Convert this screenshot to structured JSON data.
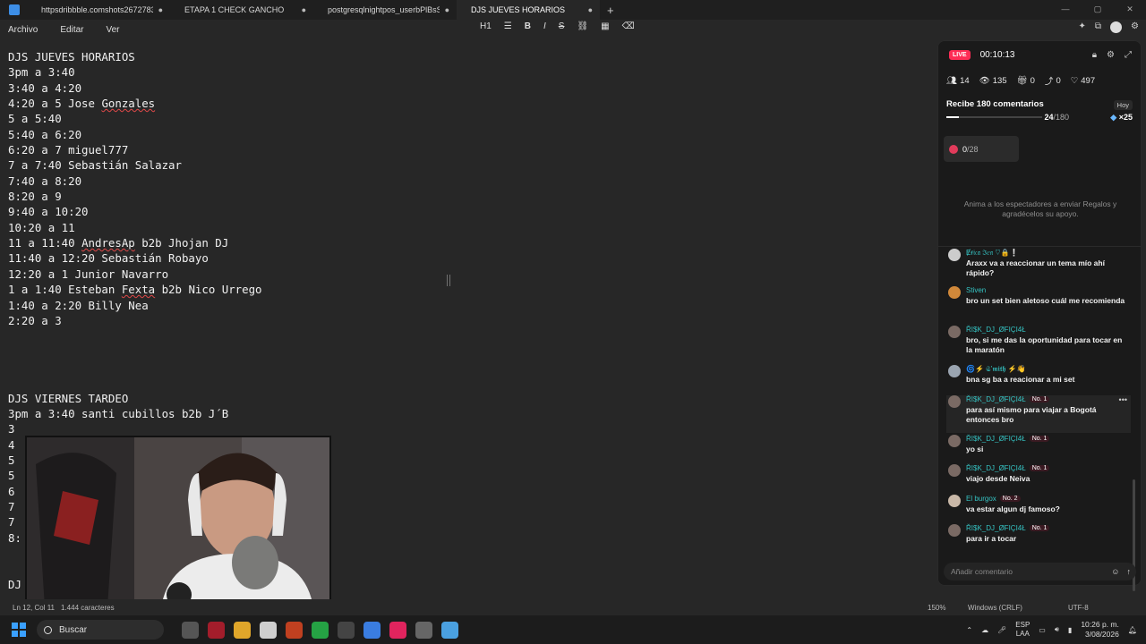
{
  "tabs": [
    {
      "label": "httpsdribbble.comshots26727839-M",
      "close": "●"
    },
    {
      "label": "ETAPA 1 CHECK GANCHO",
      "close": "●"
    },
    {
      "label": "postgresqlnightpos_userbPlBsSh6o1",
      "close": "●"
    },
    {
      "label": "DJS JUEVES HORARIOS",
      "close": "●"
    }
  ],
  "new_tab": "+",
  "window_controls": [
    "—",
    "▢",
    "✕"
  ],
  "menu": [
    "Archivo",
    "Editar",
    "Ver"
  ],
  "format_toolbar": {
    "heading": "H1",
    "list": "☰",
    "bold": "B",
    "italic": "I",
    "strike": "S",
    "link": "⛓",
    "table": "▦",
    "clear": "⌫"
  },
  "editor_lines": [
    "DJS JUEVES HORARIOS",
    "3pm a 3:40",
    "3:40 a 4:20",
    "4:20 a 5 Jose Gonzales",
    "5 a 5:40",
    "5:40 a 6:20",
    "6:20 a 7 miguel777",
    "7 a 7:40 Sebastián Salazar",
    "7:40 a 8:20",
    "8:20 a 9",
    "9:40 a 10:20",
    "10:20 a 11",
    "11 a 11:40 AndresAp b2b Jhojan DJ",
    "11:40 a 12:20 Sebastián Robayo",
    "12:20 a 1 Junior Navarro",
    "1 a 1:40 Esteban Fexta b2b Nico Urrego",
    "1:40 a 2:20 Billy Nea",
    "2:20 a 3",
    "",
    "",
    "",
    "",
    "DJS VIERNES TARDEO",
    "3pm a 3:40 santi cubillos b2b J´B",
    "3",
    "4",
    "5",
    "5",
    "6",
    "7",
    "7",
    "8:",
    "",
    "",
    "DJ"
  ],
  "status": {
    "position": "Ln 12, Col 11",
    "chars": "1.444 caracteres",
    "zoom": "150%",
    "eol": "Windows (CRLF)",
    "encoding": "UTF-8"
  },
  "taskbar": {
    "search": "Buscar",
    "lang": "ESP",
    "lang2": "LAA",
    "time": "10:26 p. m.",
    "date": "3/08/2026"
  },
  "live": {
    "badge": "LIVE",
    "timer": "00:10:13",
    "stats": {
      "users": "14",
      "views": "135",
      "gifts": "0",
      "shares": "0",
      "likes": "497"
    },
    "goal_title": "Recibe 180 comentarios",
    "goal_day": "Hoy",
    "goal_count": "24",
    "goal_total": "/180",
    "goal_reward": "×25",
    "goal_progress": 0.133,
    "gift_count": "0",
    "gift_total": "/28",
    "prompt": "Anima a los espectadores a enviar Regalos y agradécelos su apoyo.",
    "input_placeholder": "Añadir comentario"
  },
  "chat": [
    {
      "user": "Ɇɍ𝔦𝔠𝔞 ℑ𝔢𝔫 ♡🔒❕",
      "badge": "",
      "text": "Araxx va a reaccionar un tema mío ahí rápido?",
      "color": "#cccccc"
    },
    {
      "user": "Stiven",
      "badge": "",
      "text": "bro un set bien aletoso cuál me recomienda",
      "color": "#d0883a"
    },
    {
      "user": "ŘI$K_DJ_ØFIÇI4Ł",
      "badge": "",
      "text": "bro, si me das la oportunidad para tocar en la maratón",
      "color": "#7a6a64"
    },
    {
      "user": "🌀⚡ 𝕾’𝖒𝖎𝖙𝖍 ⚡👋",
      "badge": "",
      "text": "bna sg ba a reacionar a mi set",
      "color": "#9aa4b0"
    },
    {
      "user": "ŘI$K_DJ_ØFIÇI4Ł",
      "badge": "No. 1",
      "text": "para así mismo para viajar a Bogotá entonces bro",
      "color": "#7a6a64"
    },
    {
      "user": "ŘI$K_DJ_ØFIÇI4Ł",
      "badge": "No. 1",
      "text": "yo si",
      "color": "#7a6a64"
    },
    {
      "user": "ŘI$K_DJ_ØFIÇI4Ł",
      "badge": "No. 1",
      "text": "viajo desde Neiva",
      "color": "#7a6a64"
    },
    {
      "user": "El burgox",
      "badge": "No. 2",
      "text": "va estar algun dj famoso?",
      "color": "#c9b8a8"
    },
    {
      "user": "ŘI$K_DJ_ØFIÇI4Ł",
      "badge": "No. 1",
      "text": "para ir a tocar",
      "color": "#7a6a64"
    }
  ]
}
